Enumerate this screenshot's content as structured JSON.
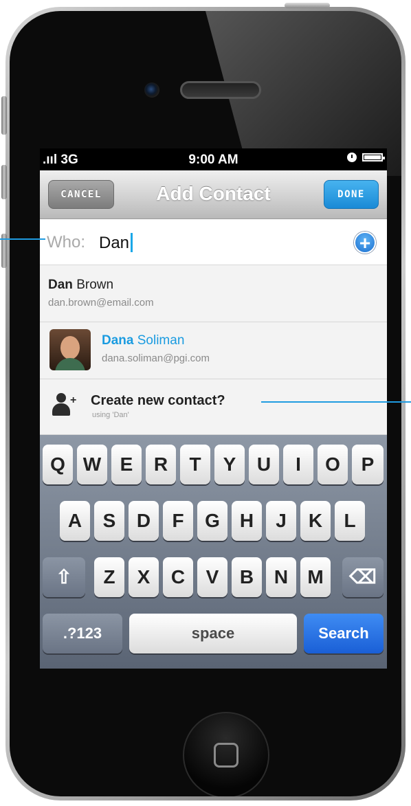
{
  "status_bar": {
    "signal": ".ııl 3G",
    "time": "9:00 AM"
  },
  "nav": {
    "title": "Add Contact",
    "cancel_label": "CANCEL",
    "done_label": "DONE"
  },
  "who": {
    "label": "Who:",
    "value": "Dan"
  },
  "results": [
    {
      "first": "Dan",
      "last": "Brown",
      "email": "dan.brown@email.com"
    },
    {
      "first": "Dana",
      "last": "Soliman",
      "email": "dana.soliman@pgi.com"
    }
  ],
  "create_contact": {
    "title": "Create new contact?",
    "subtitle": "using 'Dan'"
  },
  "keyboard": {
    "row1": [
      "Q",
      "W",
      "E",
      "R",
      "T",
      "Y",
      "U",
      "I",
      "O",
      "P"
    ],
    "row2": [
      "A",
      "S",
      "D",
      "F",
      "G",
      "H",
      "J",
      "K",
      "L"
    ],
    "row3": [
      "Z",
      "X",
      "C",
      "V",
      "B",
      "N",
      "M"
    ],
    "numbers_label": ".?123",
    "space_label": "space",
    "search_label": "Search"
  },
  "colors": {
    "accent": "#1a9be0",
    "search_key": "#1a5fd6"
  }
}
